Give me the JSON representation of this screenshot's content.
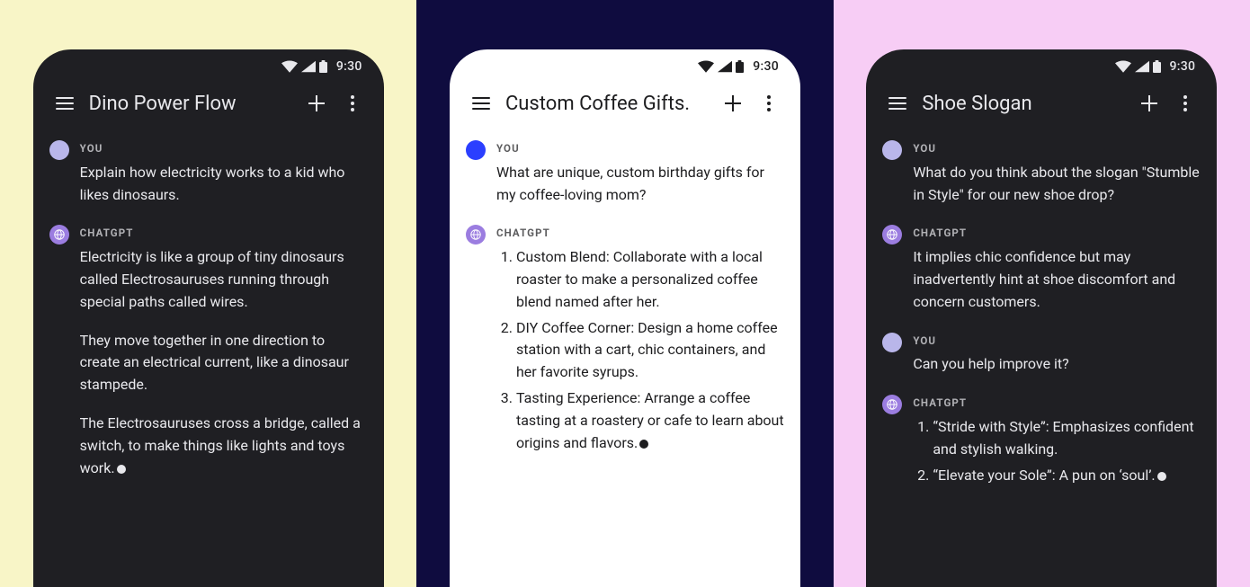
{
  "panels": [
    {
      "bg": "#f8f5c7",
      "theme": "dark",
      "status_time": "9:30",
      "title": "Dino Power Flow",
      "user_avatar_color": "#b9b6ea",
      "messages": [
        {
          "role": "YOU",
          "kind": "text",
          "text": "Explain how electricity works to a kid who likes dinosaurs."
        },
        {
          "role": "CHATGPT",
          "kind": "paragraphs",
          "paragraphs": [
            "Electricity is like a group of tiny dinosaurs called Electrosauruses running through special paths called wires.",
            "They move together in one direction to create an electrical current, like a dinosaur stampede.",
            "The Electrosauruses cross a bridge, called a switch, to make things like lights and toys work."
          ],
          "cursor": true
        }
      ]
    },
    {
      "bg": "#0f0c3f",
      "theme": "light",
      "status_time": "9:30",
      "title": "Custom Coffee Gifts.",
      "user_avatar_color": "#2b3fff",
      "messages": [
        {
          "role": "YOU",
          "kind": "text",
          "text": "What are unique, custom birthday gifts for my coffee-loving mom?"
        },
        {
          "role": "CHATGPT",
          "kind": "list",
          "items": [
            "Custom Blend: Collaborate with a local roaster to make a personalized coffee blend named after her.",
            "DIY Coffee Corner: Design a home coffee station with a cart, chic containers, and her favorite syrups.",
            "Tasting Experience: Arrange a coffee tasting at a roastery or cafe to learn about origins and flavors."
          ],
          "cursor": true
        }
      ]
    },
    {
      "bg": "#f7cdf5",
      "theme": "dark",
      "status_time": "9:30",
      "title": "Shoe Slogan",
      "user_avatar_color": "#b9b6ea",
      "messages": [
        {
          "role": "YOU",
          "kind": "text",
          "text": "What do you think about the slogan \"Stumble in Style\" for our new shoe drop?"
        },
        {
          "role": "CHATGPT",
          "kind": "text",
          "text": "It implies chic confidence but may inadvertently hint at shoe discomfort and concern customers."
        },
        {
          "role": "YOU",
          "kind": "text",
          "text": "Can you help improve it?"
        },
        {
          "role": "CHATGPT",
          "kind": "list",
          "items": [
            "“Stride with Style”: Emphasizes confident and stylish walking.",
            "“Elevate your Sole”: A pun on ‘soul’."
          ],
          "cursor": true
        }
      ]
    }
  ],
  "labels": {
    "you": "YOU",
    "gpt": "CHATGPT"
  }
}
